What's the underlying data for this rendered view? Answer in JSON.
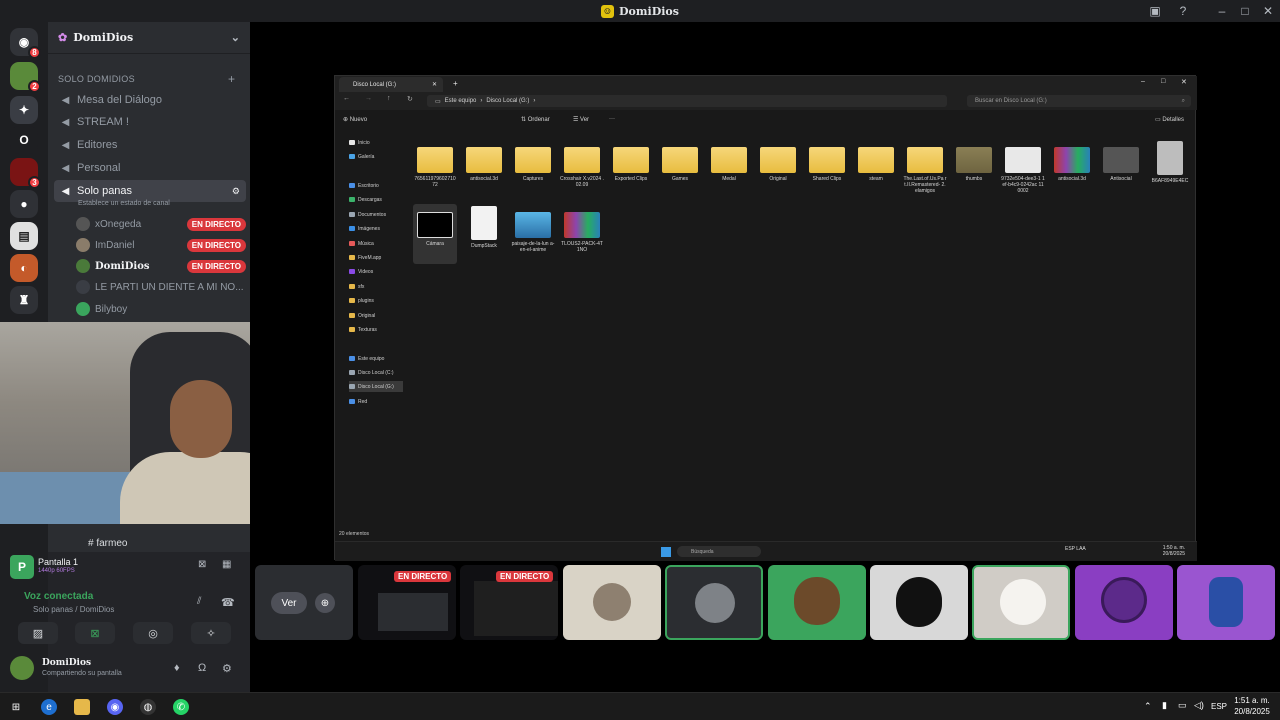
{
  "app": {
    "title": "DomiDios"
  },
  "servers": [
    {
      "badge": "8"
    },
    {
      "badge": "2"
    },
    {
      "badge": ""
    },
    {
      "badge": ""
    },
    {
      "badge": "3"
    },
    {
      "badge": ""
    },
    {
      "badge": ""
    },
    {
      "badge": ""
    }
  ],
  "sidebar": {
    "server_name": "DomiDios",
    "category": "SOLO DOMIDIOS",
    "channels": [
      "Mesa del Diálogo",
      "STREAM !",
      "Editores",
      "Personal",
      "Solo panas"
    ],
    "status_hint": "Establece un estado de canal",
    "users": [
      {
        "name": "xOnegeda",
        "live": "EN DIRECTO"
      },
      {
        "name": "ImDaniel",
        "live": "EN DIRECTO"
      },
      {
        "name": "DomiDios",
        "live": "EN DIRECTO"
      },
      {
        "name": "LE PARTI UN DIENTE A MI NO...",
        "live": ""
      },
      {
        "name": "Bilyboy",
        "live": ""
      }
    ],
    "hidden_channel": "farmeo"
  },
  "voice": {
    "screen_title": "Pantalla 1",
    "screen_sub": "1440p 60FPS",
    "connected": "Voz conectada",
    "channel_path": "Solo panas / DomiDios",
    "user_name": "DomiDios",
    "user_status": "Compartiendo su pantalla"
  },
  "explorer": {
    "tab": "Disco Local (G:)",
    "breadcrumb": [
      "Este equipo",
      "Disco Local (G:)"
    ],
    "search_placeholder": "Buscar en Disco Local (G:)",
    "new_label": "Nuevo",
    "sort_label": "Ordenar",
    "view_label": "Ver",
    "details_label": "Detalles",
    "nav": [
      "Inicio",
      "Galería",
      "Escritorio",
      "Descargas",
      "Documentos",
      "Imágenes",
      "Música",
      "FiveM.app",
      "Videos",
      "sfx",
      "plugins",
      "Original",
      "Texturas",
      "Este equipo",
      "Disco Local (C:)",
      "Disco Local (G:)",
      "Red"
    ],
    "files": [
      "765611979602710 72",
      "antisocial.3d",
      "Captures",
      "Crosshair X.v2024 .02.09",
      "Exported Clips",
      "Games",
      "Medal",
      "Original",
      "Shared Clips",
      "steam",
      "The.Last.of.Us.Pa rt.II.Remastered- 2.elamigos",
      "thumbs",
      "9732e504-dee3-1 1ef-b4c9-0242ac 110002",
      "antisocial.3d",
      "Antisocial",
      "B6AF8949E4EC",
      "Cámara",
      "DumpStack",
      "paisaje-de-la-lun a-en-el-anime",
      "TLOUS2-PACK-4T 1NO"
    ],
    "status": "20 elementos",
    "task_search": "Búsqueda",
    "lang": "ESP LAA",
    "time": "1:50 a. m.",
    "date": "20/8/2025"
  },
  "strip": {
    "ver_label": "Ver",
    "live": "EN DIRECTO"
  },
  "taskbar": {
    "lang": "ESP",
    "time": "1:51 a. m.",
    "date": "20/8/2025"
  }
}
